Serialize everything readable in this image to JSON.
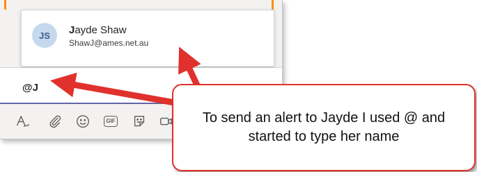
{
  "mention_suggestion": {
    "initials": "JS",
    "name_bold": "J",
    "name_rest": "ayde Shaw",
    "email": "ShawJ@ames.net.au"
  },
  "compose": {
    "input_value": "@J"
  },
  "toolbar": {
    "gif_label": "GIF",
    "icons": [
      "format-icon",
      "attach-icon",
      "emoji-icon",
      "gif-icon",
      "sticker-icon",
      "meet-now-icon"
    ]
  },
  "callout": {
    "text": "To send an alert to Jayde I used @ and started to type her name"
  },
  "colors": {
    "arrow": "#e0312c",
    "teams_purple": "#6264a7",
    "avatar_bg": "#c5d8ee"
  }
}
